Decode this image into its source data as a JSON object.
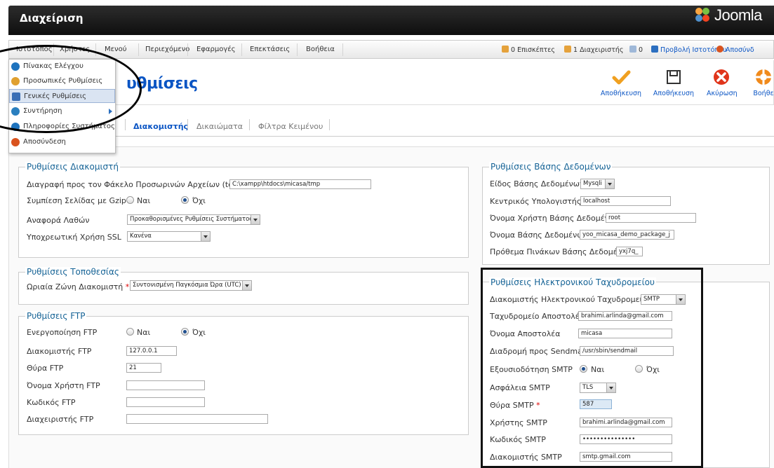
{
  "header": {
    "title": "Διαχείριση",
    "logo_text": "Joomla"
  },
  "menu": {
    "items": [
      "Ιστότοπος",
      "Χρήστες",
      "Μενού",
      "Περιεχόμενο",
      "Εφαρμογές",
      "Επεκτάσεις",
      "Βοήθεια"
    ],
    "status": {
      "visitors": "0 Επισκέπτες",
      "admins": "1 Διαχειριστής",
      "messages": "0",
      "view_site": "Προβολή Ιστοτόπου",
      "logout": "Αποσύνδ"
    }
  },
  "dropdown": {
    "items": [
      {
        "label": "Πίνακας Ελέγχου",
        "icon": "dashboard-icon",
        "color": "#1e73be"
      },
      {
        "label": "Προσωπικές Ρυθμίσεις",
        "icon": "user-icon",
        "color": "#e0a030"
      },
      {
        "label": "Γενικές Ρυθμίσεις",
        "icon": "tools-icon",
        "color": "#3a6fb5"
      },
      {
        "label": "Συντήρηση",
        "icon": "gear-icon",
        "color": "#2a7fbf"
      },
      {
        "label": "Πληροφορίες Συστήματος",
        "icon": "info-icon",
        "color": "#1e73be"
      },
      {
        "label": "Αποσύνδεση",
        "icon": "logout-icon",
        "color": "#d9531e"
      }
    ]
  },
  "page": {
    "title": "Γενικές Ρυθμίσεις",
    "title_visible": "υθμίσεις"
  },
  "toolbar": {
    "save": "Αποθήκευση",
    "save_close": "Αποθήκευση",
    "cancel": "Ακύρωση",
    "help": "Βοήθε"
  },
  "tabs": [
    "Διακομιστής",
    "Δικαιώματα",
    "Φίλτρα Κειμένου"
  ],
  "server": {
    "legend": "Ρυθμίσεις Διακομιστή",
    "temp_label": "Διαγραφή προς τον Φάκελο Προσωρινών Αρχείων (temp)",
    "temp_value": "C:\\xampp\\htdocs\\micasa/tmp",
    "gzip_label": "Συμπίεση Σελίδας με Gzip",
    "yes": "Ναι",
    "no": "Όχι",
    "error_label": "Αναφορά Λαθών",
    "error_value": "Προκαθορισμένες Ρυθμίσεις Συστήματος",
    "ssl_label": "Υποχρεωτική Χρήση SSL",
    "ssl_value": "Κανένα"
  },
  "locale": {
    "legend": "Ρυθμίσεις Τοποθεσίας",
    "tz_label": "Ωριαία Ζώνη Διακομιστή",
    "tz_value": "Συντονισμένη Παγκόσμια Ώρα (UTC)"
  },
  "ftp": {
    "legend": "Ρυθμίσεις FTP",
    "enable_label": "Ενεργοποίηση FTP",
    "yes": "Ναι",
    "no": "Όχι",
    "host_label": "Διακομιστής FTP",
    "host_value": "127.0.0.1",
    "port_label": "Θύρα FTP",
    "port_value": "21",
    "user_label": "Όνομα Χρήστη FTP",
    "pass_label": "Κωδικός FTP",
    "root_label": "Διαχειριστής FTP"
  },
  "database": {
    "legend": "Ρυθμίσεις Βάσης Δεδομένων",
    "type_label": "Είδος Βάσης Δεδομένων",
    "type_value": "Mysqli",
    "host_label": "Κεντρικός Υπολογιστής",
    "host_value": "localhost",
    "user_label": "Όνομα Χρήστη Βάσης Δεδομένων",
    "user_value": "root",
    "name_label": "Όνομα Βάσης Δεδομένων",
    "name_value": "yoo_micasa_demo_package_j",
    "prefix_label": "Πρόθεμα Πινάκων Βάσης Δεδομένων",
    "prefix_value": "yxj7q_"
  },
  "mail": {
    "legend": "Ρυθμίσεις Ηλεκτρονικού Ταχυδρομείου",
    "mailer_label": "Διακομιστής Ηλεκτρονικού Ταχυδρομείου",
    "mailer_value": "SMTP",
    "from_label": "Ταχυδρομείο Αποστολέα",
    "from_value": "brahimi.arlinda@gmail.com",
    "fromname_label": "Όνομα Αποστολέα",
    "fromname_value": "micasa",
    "sendmail_label": "Διαδρομή προς Sendmail",
    "sendmail_value": "/usr/sbin/sendmail",
    "auth_label": "Εξουσιοδότηση SMTP",
    "yes": "Ναι",
    "no": "Όχι",
    "secure_label": "Ασφάλεια SMTP",
    "secure_value": "TLS",
    "port_label": "Θύρα SMTP",
    "port_value": "587",
    "user_label": "Χρήστης SMTP",
    "user_value": "brahimi.arlinda@gmail.com",
    "pass_label": "Κωδικός SMTP",
    "pass_value": "•••••••••••••••",
    "host_label": "Διακομιστής SMTP",
    "host_value": "smtp.gmail.com"
  }
}
